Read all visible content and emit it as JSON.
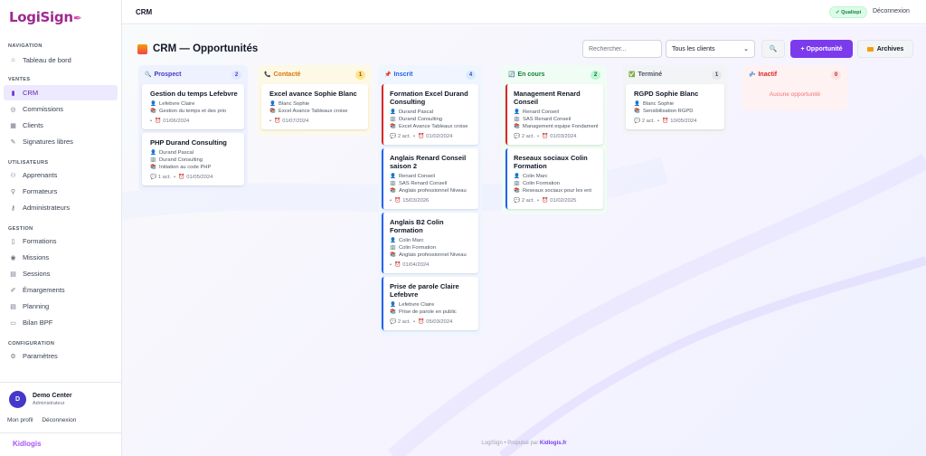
{
  "app": {
    "logo": "LogiSign",
    "logo_pen": "✒"
  },
  "topbar": {
    "title": "CRM",
    "badge": "✓ Qualiopi",
    "logout": "Déconnexion"
  },
  "sidebar": {
    "sections": [
      {
        "label": "NAVIGATION",
        "items": [
          {
            "label": "Tableau de bord",
            "icon": "home-icon"
          }
        ]
      },
      {
        "label": "VENTES",
        "items": [
          {
            "label": "CRM",
            "icon": "bar-chart-icon",
            "active": true
          },
          {
            "label": "Commissions",
            "icon": "coins-icon"
          },
          {
            "label": "Clients",
            "icon": "building-icon"
          },
          {
            "label": "Signatures libres",
            "icon": "pen-icon"
          }
        ]
      },
      {
        "label": "UTILISATEURS",
        "items": [
          {
            "label": "Apprenants",
            "icon": "users-icon"
          },
          {
            "label": "Formateurs",
            "icon": "user-icon"
          },
          {
            "label": "Administrateurs",
            "icon": "key-icon"
          }
        ]
      },
      {
        "label": "GESTION",
        "items": [
          {
            "label": "Formations",
            "icon": "book-icon"
          },
          {
            "label": "Missions",
            "icon": "target-icon"
          },
          {
            "label": "Sessions",
            "icon": "calendar-icon"
          },
          {
            "label": "Émargements",
            "icon": "edit-icon"
          },
          {
            "label": "Planning",
            "icon": "calendar-icon"
          },
          {
            "label": "Bilan BPF",
            "icon": "document-icon"
          }
        ]
      },
      {
        "label": "CONFIGURATION",
        "items": [
          {
            "label": "Paramètres",
            "icon": "gear-icon"
          }
        ]
      }
    ],
    "user": {
      "initial": "D",
      "name": "Demo Center",
      "role": "Administrateur"
    },
    "links": {
      "profile": "Mon profil",
      "logout": "Déconnexion"
    },
    "footer_logo": "Kidlogis"
  },
  "page": {
    "title": "CRM — Opportunités",
    "search_placeholder": "Rechercher...",
    "client_select": "Tous les clients",
    "new_button": "+ Opportunité",
    "archives_button": "Archives"
  },
  "columns": [
    {
      "key": "prospect",
      "label": "Prospect",
      "icon": "🔍",
      "count": "2",
      "color": "#4338ca",
      "bg": "#eef2ff",
      "count_bg": "#e0e7ff",
      "count_color": "#4338ca",
      "cards": [
        {
          "title": "Gestion du temps Lefebvre",
          "lines": [
            "Lefebvre Claire",
            "Gestion du temps et des prio"
          ],
          "line_icons": [
            "👤",
            "📚"
          ],
          "acts": "",
          "date": "01/06/2024"
        },
        {
          "title": "PHP Durand Consulting",
          "lines": [
            "Durand Pascal",
            "Durand Consulting",
            "Initiation au code PHP"
          ],
          "line_icons": [
            "👤",
            "🏢",
            "📚"
          ],
          "acts": "1 act.",
          "date": "01/05/2024"
        }
      ]
    },
    {
      "key": "contacte",
      "label": "Contacté",
      "icon": "📞",
      "count": "1",
      "color": "#d97706",
      "bg": "#fef9e7",
      "count_bg": "#fde68a",
      "count_color": "#92400e",
      "cards": [
        {
          "title": "Excel avance Sophie Blanc",
          "lines": [
            "Blanc Sophie",
            "Excel Avance Tableaux croise"
          ],
          "line_icons": [
            "👤",
            "📚"
          ],
          "acts": "",
          "date": "01/07/2024"
        }
      ]
    },
    {
      "key": "inscrit",
      "label": "Inscrit",
      "icon": "📌",
      "count": "4",
      "color": "#2563eb",
      "bg": "#eff6ff",
      "count_bg": "#dbeafe",
      "count_color": "#1d4ed8",
      "cards": [
        {
          "title": "Formation Excel Durand Consulting",
          "lines": [
            "Durand Pascal",
            "Durand Consulting",
            "Excel Avance Tableaux croise"
          ],
          "line_icons": [
            "👤",
            "🏢",
            "📚"
          ],
          "acts": "2 act.",
          "date": "01/02/2024",
          "border": "#dc2626"
        },
        {
          "title": "Anglais Renard Conseil saison 2",
          "lines": [
            "Renard Conseil",
            "SAS Renard Conseil",
            "Anglais professionnel Niveau"
          ],
          "line_icons": [
            "👤",
            "🏢",
            "📚"
          ],
          "acts": "",
          "date": "15/03/2026",
          "border": "#2563eb"
        },
        {
          "title": "Anglais B2 Colin Formation",
          "lines": [
            "Colin Marc",
            "Colin Formation",
            "Anglais professionnel Niveau"
          ],
          "line_icons": [
            "👤",
            "🏢",
            "📚"
          ],
          "acts": "",
          "date": "01/04/2024",
          "border": "#2563eb"
        },
        {
          "title": "Prise de parole Claire Lefebvre",
          "lines": [
            "Lefebvre Claire",
            "Prise de parole en public"
          ],
          "line_icons": [
            "👤",
            "📚"
          ],
          "acts": "2 act.",
          "date": "05/03/2024",
          "border": "#2563eb"
        }
      ]
    },
    {
      "key": "en-cours",
      "label": "En cours",
      "icon": "🔄",
      "count": "2",
      "color": "#15803d",
      "bg": "#f0fdf4",
      "count_bg": "#bbf7d0",
      "count_color": "#166534",
      "cards": [
        {
          "title": "Management Renard Conseil",
          "lines": [
            "Renard Conseil",
            "SAS Renard Conseil",
            "Management equipe Fondamenta"
          ],
          "line_icons": [
            "👤",
            "🏢",
            "📚"
          ],
          "acts": "2 act.",
          "date": "01/03/2024",
          "border": "#dc2626"
        },
        {
          "title": "Reseaux sociaux Colin Formation",
          "lines": [
            "Colin Marc",
            "Colin Formation",
            "Reseaux sociaux pour les ent"
          ],
          "line_icons": [
            "👤",
            "🏢",
            "📚"
          ],
          "acts": "2 act.",
          "date": "01/02/2025",
          "border": "#2563eb"
        }
      ]
    },
    {
      "key": "termine",
      "label": "Terminé",
      "icon": "✅",
      "count": "1",
      "color": "#4b5563",
      "bg": "#f3f4f6",
      "count_bg": "#e5e7eb",
      "count_color": "#374151",
      "cards": [
        {
          "title": "RGPD Sophie Blanc",
          "lines": [
            "Blanc Sophie",
            "Sensibilisation RGPD"
          ],
          "line_icons": [
            "👤",
            "📚"
          ],
          "acts": "2 act.",
          "date": "10/05/2024"
        }
      ]
    },
    {
      "key": "inactif",
      "label": "Inactif",
      "icon": "💤",
      "count": "0",
      "color": "#dc2626",
      "bg": "#fef2f2",
      "count_bg": "#fee2e2",
      "count_color": "#b91c1c",
      "empty": "Aucune opportunité",
      "cards": []
    }
  ],
  "footer": {
    "text": "LogiSign • Propulsé par",
    "brand": "Kidlogis.fr"
  }
}
